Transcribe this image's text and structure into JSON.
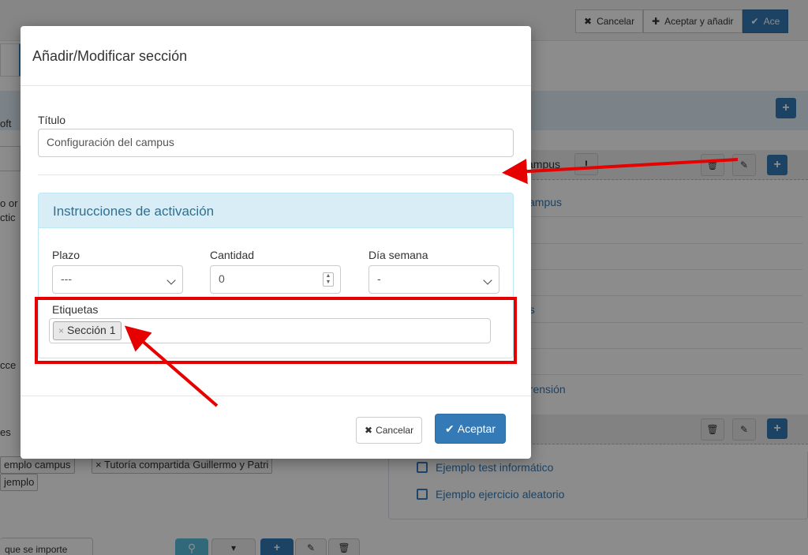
{
  "background": {
    "top_actions": {
      "cancel_label": "Cancelar",
      "accept_add_label": "Aceptar y añadir",
      "accept_label": "Ace"
    },
    "left_stubs": [
      "oft",
      "o or",
      "ctic",
      "cce",
      "es"
    ],
    "section_row_label": "ampus",
    "section_row_mark": "!",
    "links": [
      "campus",
      "as",
      "prensión"
    ],
    "bottom_tags": [
      "emplo campus",
      "× Tutoría compartida Guillermo y Patri",
      "jemplo"
    ],
    "bottom_links": [
      "Ejemplo test informático",
      "Ejemplo ejercicio aleatorio"
    ],
    "bottom_left_text": "que se importe"
  },
  "modal": {
    "title": "Añadir/Modificar sección",
    "titulo_label": "Título",
    "titulo_value": "Configuración del campus",
    "panel_title": "Instrucciones de activación",
    "plazo_label": "Plazo",
    "plazo_value": "---",
    "cantidad_label": "Cantidad",
    "cantidad_value": "0",
    "dia_label": "Día semana",
    "dia_value": "-",
    "etiquetas_label": "Etiquetas",
    "tags": [
      "Sección 1"
    ],
    "cancel_label": "Cancelar",
    "accept_label": "Aceptar"
  },
  "colors": {
    "primary": "#337ab7",
    "panel_heading_bg": "#d9edf7",
    "panel_heading_text": "#31708f",
    "annotation_red": "#e60000"
  }
}
